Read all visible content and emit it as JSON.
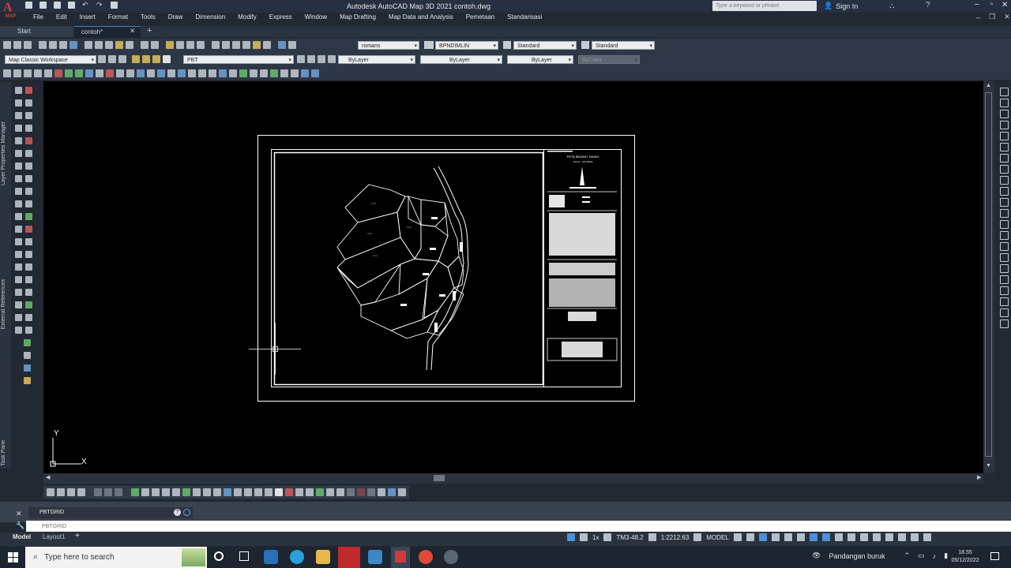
{
  "app": {
    "title": "Autodesk AutoCAD Map 3D 2021   contoh.dwg",
    "logo_letter": "A",
    "logo_sub": "MAP",
    "search_placeholder": "Type a keyword or phrase",
    "signin_label": "Sign In"
  },
  "menu": [
    "File",
    "Edit",
    "Insert",
    "Format",
    "Tools",
    "Draw",
    "Dimension",
    "Modify",
    "Express",
    "Window",
    "Map Drafting",
    "Map Data and Analysis",
    "Pemetaan",
    "Standarisasi"
  ],
  "tabs": {
    "start": "Start",
    "drawing": "contoh*"
  },
  "toolbar": {
    "text_style": "romans",
    "dim_style": "BPNDIMLIN",
    "table_style": "Standard",
    "mleader_style": "Standard",
    "workspace": "Map Classic Workspace",
    "layer": "PBT",
    "color": "ByLayer",
    "linetype": "ByLayer",
    "lineweight": "ByLayer",
    "plotstyle": "ByColor"
  },
  "left_panels": {
    "layer_properties": "Layer Properties Manager",
    "external_references": "External References",
    "task_pane": "Task Pane"
  },
  "drawing": {
    "title_block_heading": "PETA BIDANG TANAH",
    "title_block_sub": "Nomor :  21/7/2022",
    "ucs_x": "X",
    "ucs_y": "Y",
    "parcel_labels": [
      "xxxx",
      "xxxx",
      "xxxx",
      "xxxx",
      "xxxx"
    ]
  },
  "command": {
    "history": "PBTGRID",
    "input_value": "PBTGRID"
  },
  "layout_tabs": [
    "Model",
    "Layout1"
  ],
  "status": {
    "coord_system": "TM3-48.2",
    "scale": "1:2212.63",
    "space": "MODEL",
    "annotation_scale": "1x"
  },
  "taskbar": {
    "search_placeholder": "Type here to search",
    "weather": "Pandangan buruk",
    "time": "18.55",
    "date": "05/12/2022"
  }
}
